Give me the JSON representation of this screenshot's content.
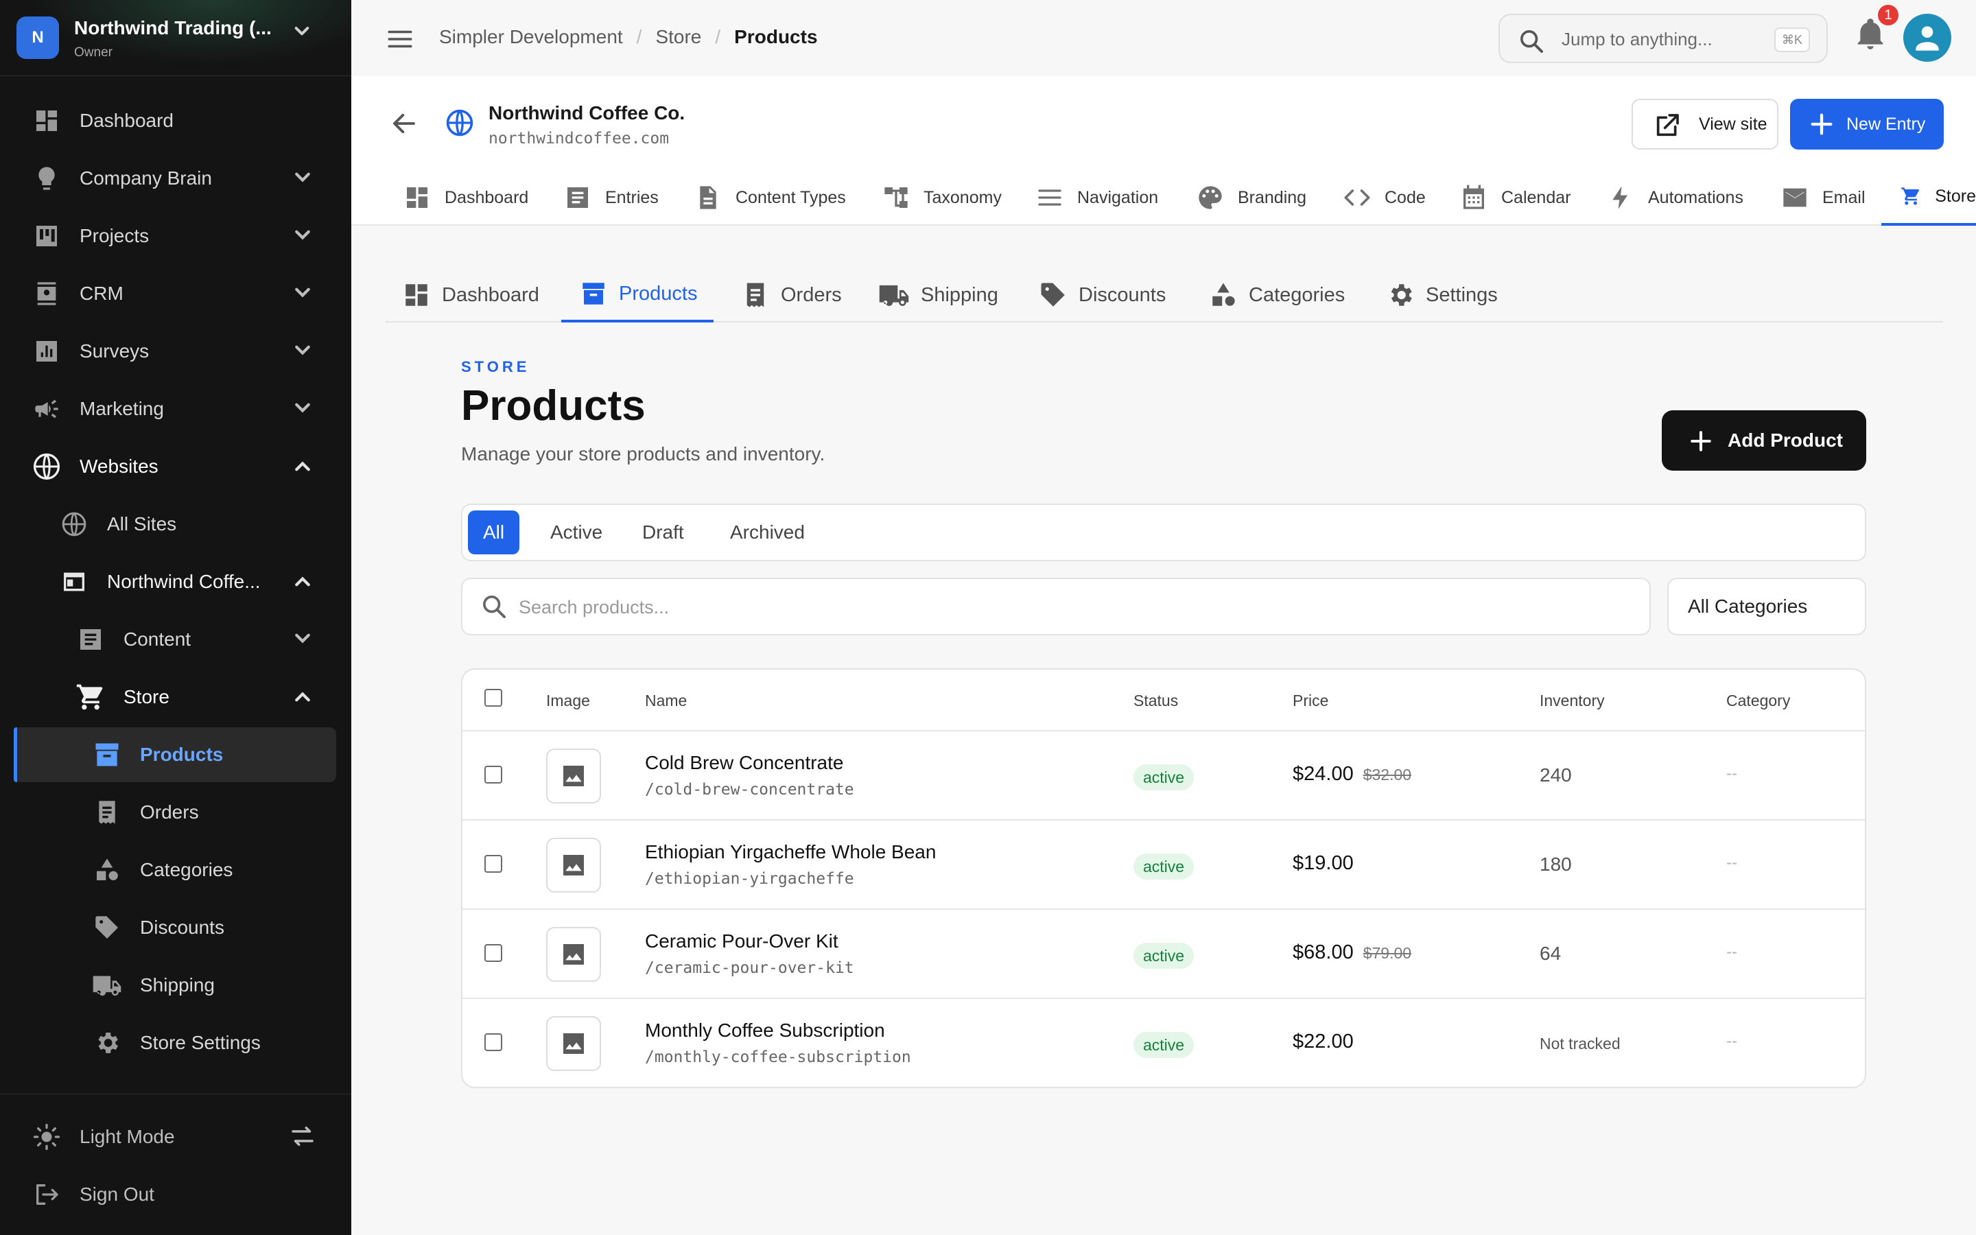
{
  "org": {
    "initial": "N",
    "name": "Northwind Trading (...",
    "role": "Owner"
  },
  "sidebar": {
    "items": [
      {
        "label": "Dashboard"
      },
      {
        "label": "Company Brain"
      },
      {
        "label": "Projects"
      },
      {
        "label": "CRM"
      },
      {
        "label": "Surveys"
      },
      {
        "label": "Marketing"
      },
      {
        "label": "Websites"
      },
      {
        "label": "All Sites"
      },
      {
        "label": "Northwind Coffe..."
      },
      {
        "label": "Content"
      },
      {
        "label": "Store"
      },
      {
        "label": "Products"
      },
      {
        "label": "Orders"
      },
      {
        "label": "Categories"
      },
      {
        "label": "Discounts"
      },
      {
        "label": "Shipping"
      },
      {
        "label": "Store Settings"
      }
    ],
    "bottom": {
      "light_mode": "Light Mode",
      "sign_out": "Sign Out"
    }
  },
  "topbar": {
    "breadcrumb": [
      "Simpler Development",
      "/",
      "Store",
      "/",
      "Products"
    ],
    "search_placeholder": "Jump to anything...",
    "shortcut": "⌘K",
    "notifications": "1"
  },
  "site": {
    "name": "Northwind Coffee Co.",
    "domain": "northwindcoffee.com",
    "view_site": "View site",
    "new_entry": "New Entry",
    "tabs": [
      "Dashboard",
      "Entries",
      "Content Types",
      "Taxonomy",
      "Navigation",
      "Branding",
      "Code",
      "Calendar",
      "Automations",
      "Email",
      "Store"
    ]
  },
  "store_tabs": [
    "Dashboard",
    "Products",
    "Orders",
    "Shipping",
    "Discounts",
    "Categories",
    "Settings"
  ],
  "page": {
    "eyebrow": "STORE",
    "title": "Products",
    "subtitle": "Manage your store products and inventory.",
    "add_button": "Add Product",
    "status_filters": [
      "All",
      "Active",
      "Draft",
      "Archived"
    ],
    "search_placeholder": "Search products...",
    "category_filter": "All Categories"
  },
  "table": {
    "headers": [
      "Image",
      "Name",
      "Status",
      "Price",
      "Inventory",
      "Category"
    ],
    "rows": [
      {
        "name": "Cold Brew Concentrate",
        "slug": "/cold-brew-concentrate",
        "status": "active",
        "price": "$24.00",
        "compare_price": "$32.00",
        "inventory": "240",
        "category": "--"
      },
      {
        "name": "Ethiopian Yirgacheffe Whole Bean",
        "slug": "/ethiopian-yirgacheffe",
        "status": "active",
        "price": "$19.00",
        "compare_price": "",
        "inventory": "180",
        "category": "--"
      },
      {
        "name": "Ceramic Pour-Over Kit",
        "slug": "/ceramic-pour-over-kit",
        "status": "active",
        "price": "$68.00",
        "compare_price": "$79.00",
        "inventory": "64",
        "category": "--"
      },
      {
        "name": "Monthly Coffee Subscription",
        "slug": "/monthly-coffee-subscription",
        "status": "active",
        "price": "$22.00",
        "compare_price": "",
        "inventory": "Not tracked",
        "category": "--"
      }
    ]
  },
  "colors": {
    "accent": "#2163e8",
    "sidebar_bg": "#141414",
    "active_badge_bg": "#e3f6e8",
    "active_badge_text": "#16803c"
  }
}
